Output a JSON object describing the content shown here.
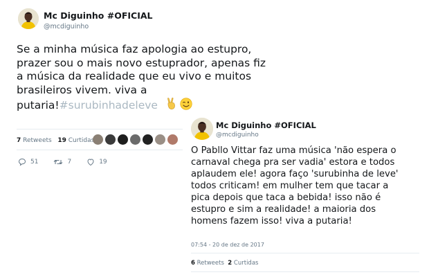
{
  "tweets": [
    {
      "author": {
        "name": "Mc Diguinho #OFICIAL",
        "handle": "@mcdiguinho"
      },
      "text_lines": [
        "Se a minha música faz apologia ao estupro,",
        "prazer sou o mais novo estuprador, apenas fiz",
        "a música da realidade que eu vivo e muitos",
        "brasileiros vivem. viva a"
      ],
      "last_line_text": "putaria!",
      "hashtag": "#surubinhadeleve",
      "emojis": [
        "victory-hand-emoji",
        "winking-face-emoji"
      ],
      "stats": {
        "retweets_count": "7",
        "retweets_label": "Retweets",
        "likes_count": "19",
        "likes_label": "Curtidas"
      },
      "likers": [
        "#8a7f74",
        "#3b3b3b",
        "#1e1e1e",
        "#6b6b6b",
        "#222222",
        "#9a8f86",
        "#b07a6a"
      ],
      "actions": {
        "reply_count": "51",
        "retweet_count": "7",
        "like_count": "19"
      }
    },
    {
      "author": {
        "name": "Mc Diguinho #OFICIAL",
        "handle": "@mcdiguinho"
      },
      "text_lines": [
        "O Pabllo Vittar faz uma música 'não espera o",
        "carnaval chega pra ser vadia' estora e todos",
        "aplaudem ele! agora faço 'surubinha de leve'",
        "todos criticam! em mulher tem que tacar a",
        "pica depois que taca a bebida! isso não é",
        "estupro e sim a realidade! a maioria dos",
        "homens fazem isso! viva a putaria!"
      ],
      "timestamp": "07:54 - 20 de dez de 2017",
      "stats": {
        "retweets_count": "6",
        "retweets_label": "Retweets",
        "likes_count": "2",
        "likes_label": "Curtidas"
      }
    }
  ],
  "colors": {
    "text": "#14171a",
    "secondary": "#657786",
    "hashtag": "#aab8c2",
    "divider": "#e6ecf0",
    "avatar_bg": "#e8e3d0",
    "shirt_yellow": "#f2c200"
  }
}
